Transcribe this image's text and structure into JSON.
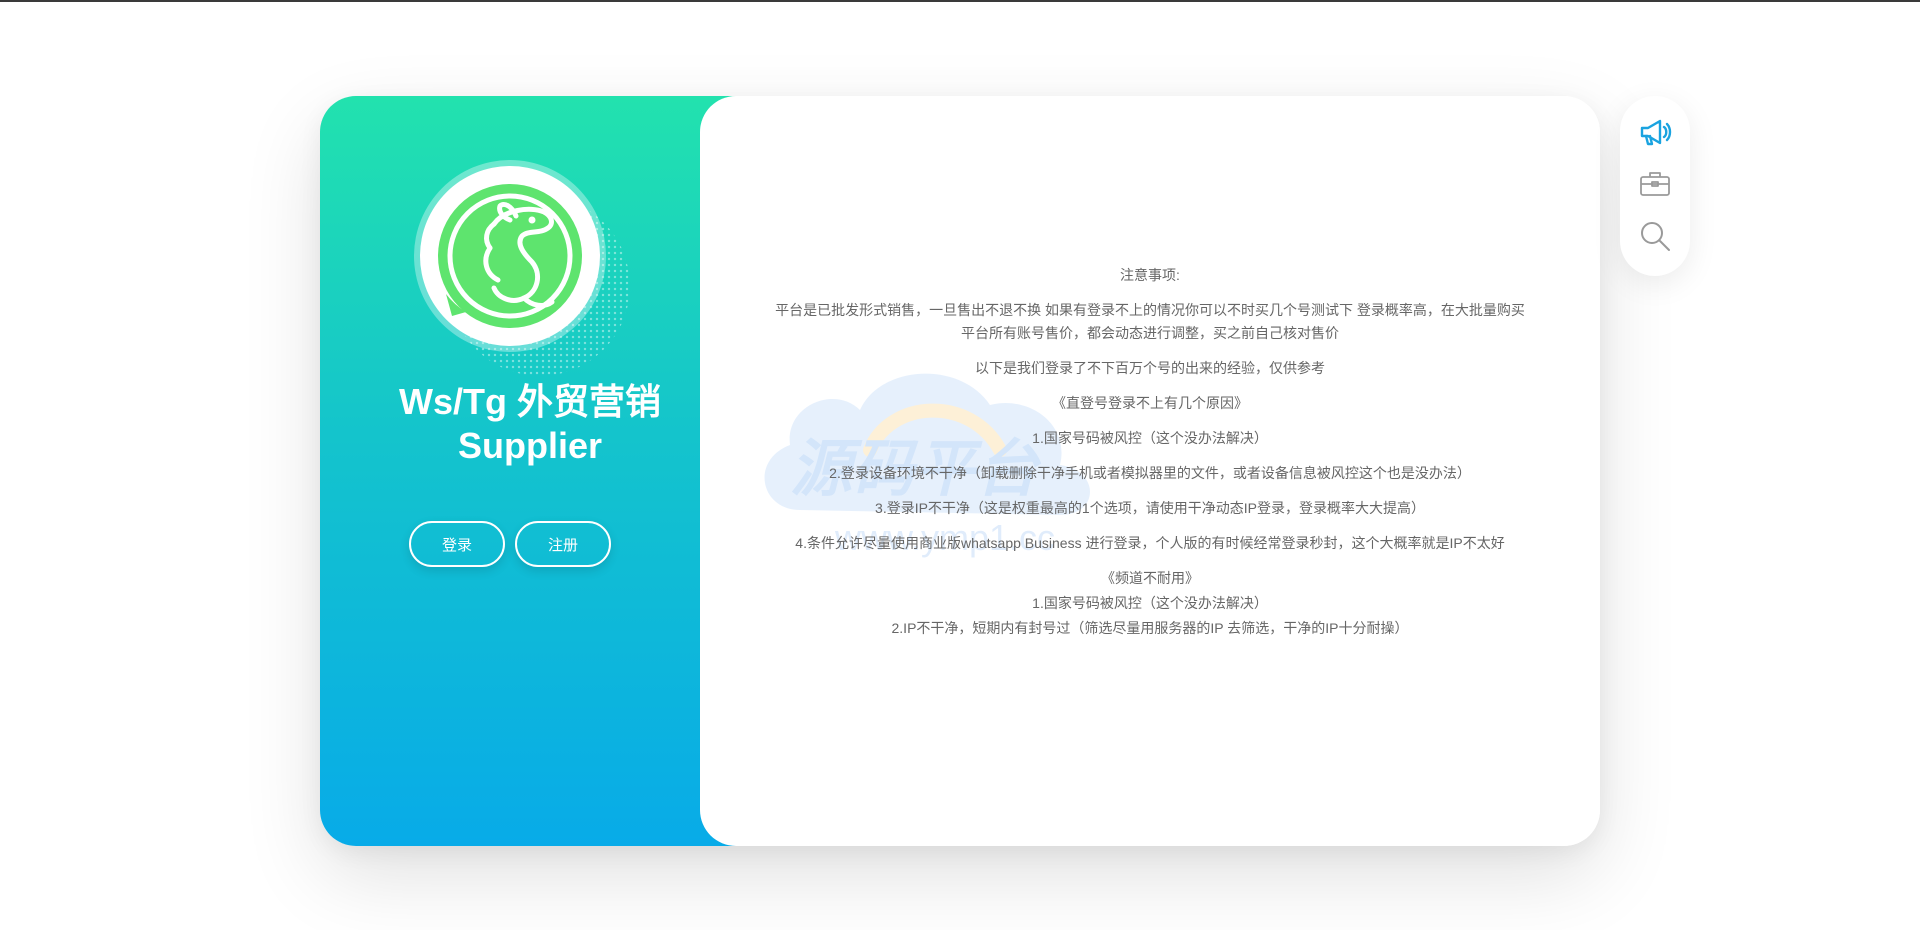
{
  "brand": {
    "title_line1": "Ws/Tg 外贸营销",
    "title_line2": "Supplier"
  },
  "auth": {
    "login_label": "登录",
    "register_label": "注册"
  },
  "notice": {
    "heading": "注意事项:",
    "intro": "平台是已批发形式销售，一旦售出不退不换 如果有登录不上的情况你可以不时买几个号测试下 登录概率高，在大批量购买 平台所有账号售价，都会动态进行调整，买之前自己核对售价",
    "experience": "以下是我们登录了不下百万个号的出来的经验，仅供参考",
    "section1_title": "《直登号登录不上有几个原因》",
    "section1_items": [
      "1.国家号码被风控（这个没办法解决）",
      "2.登录设备环境不干净（卸载删除干净手机或者模拟器里的文件，或者设备信息被风控这个也是没办法）",
      "3.登录IP不干净（这是权重最高的1个选项，请使用干净动态IP登录，登录概率大大提高）",
      "4.条件允许尽量使用商业版whatsapp Business 进行登录，个人版的有时候经常登录秒封，这个大概率就是IP不太好"
    ],
    "section2_title": "《频道不耐用》",
    "section2_items": [
      "1.国家号码被风控（这个没办法解决）",
      "2.IP不干净，短期内有封号过（筛选尽量用服务器的IP 去筛选，干净的IP十分耐操）"
    ]
  },
  "watermark": {
    "text_main": "源码平台",
    "text_url": "www.ymp1.cc"
  },
  "toolbar": {
    "icons": [
      "megaphone-icon",
      "briefcase-icon",
      "search-icon"
    ]
  },
  "colors": {
    "gradient_top": "#22e2ae",
    "gradient_bottom": "#08abe8",
    "logo_green": "#5ee46e",
    "accent_blue": "#1aa3e0",
    "text_gray": "#666666"
  }
}
